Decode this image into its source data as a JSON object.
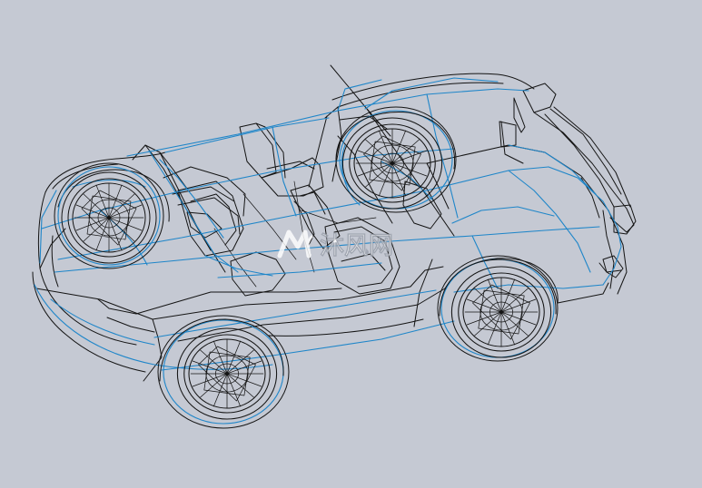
{
  "viewport": {
    "background": "#c5c9d3",
    "edge_color": "#141414",
    "accent_edge_color": "#1f86c9"
  },
  "watermark": {
    "logo_icon": "mf-logo-icon",
    "text": "沐风网",
    "color": "#ffffff"
  }
}
